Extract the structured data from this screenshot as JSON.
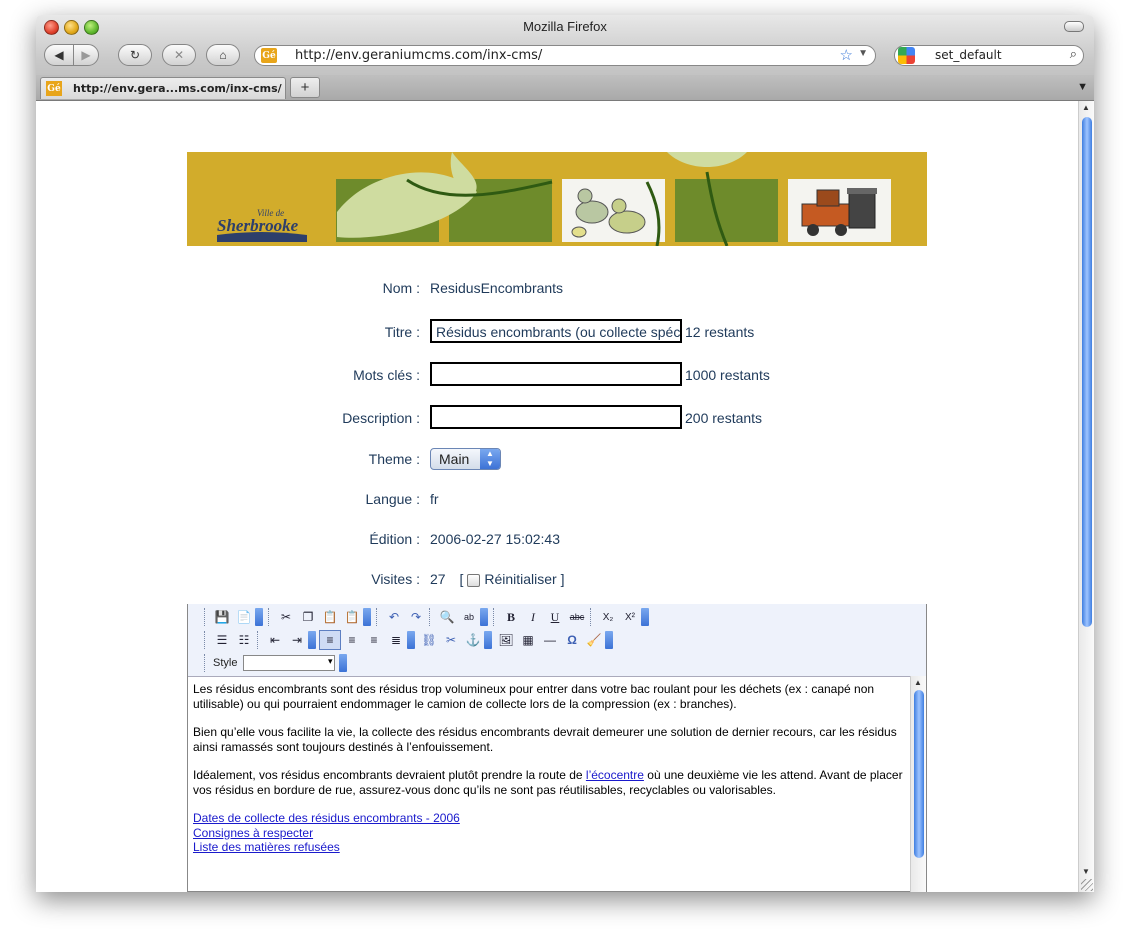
{
  "window": {
    "title": "Mozilla Firefox"
  },
  "nav": {
    "url": "http://env.geraniumcms.com/inx-cms/",
    "favicon_text": "Gé",
    "search_value": "set_default"
  },
  "tabs": [
    {
      "label": "http://env.gera...ms.com/inx-cms/"
    }
  ],
  "newtab_label": "+",
  "banner": {
    "logo_line1": "Ville de",
    "logo_line2": "Sherbrooke"
  },
  "form": {
    "nom": {
      "label": "Nom :",
      "value": "ResidusEncombrants"
    },
    "titre": {
      "label": "Titre :",
      "value": "Résidus encombrants (ou collecte spéciale)",
      "remaining": "12 restants"
    },
    "mots_cles": {
      "label": "Mots clés :",
      "value": "",
      "remaining": "1000 restants"
    },
    "description": {
      "label": "Description :",
      "value": "",
      "remaining": "200 restants"
    },
    "theme": {
      "label": "Theme :",
      "value": "Main"
    },
    "langue": {
      "label": "Langue :",
      "value": "fr"
    },
    "edition": {
      "label": "Édition :",
      "value": "2006-02-27 15:02:43"
    },
    "visites": {
      "label": "Visites :",
      "value": "27",
      "reset_label": "Réinitialiser",
      "open_bracket": "[",
      "close_bracket": "]"
    }
  },
  "editor": {
    "style_label": "Style",
    "paragraphs": [
      "Les résidus encombrants sont des résidus trop volumineux pour entrer dans votre bac roulant pour les déchets (ex : canapé non utilisable) ou qui pourraient endommager le camion de collecte lors de la compression (ex : branches).",
      "Bien qu’elle vous facilite la vie, la collecte des résidus encombrants devrait demeurer une solution de dernier recours, car les résidus ainsi ramassés sont toujours destinés à l’enfouissement."
    ],
    "p3_before": "Idéalement, vos résidus encombrants devraient plutôt prendre la route de ",
    "p3_link": "l’écocentre",
    "p3_after": " où une deuxième vie les attend. Avant de placer vos résidus en bordure de rue, assurez-vous donc qu’ils ne sont pas réutilisables, recyclables ou valorisables.",
    "links": [
      "Dates de collecte des résidus encombrants - 2006",
      "Consignes à respecter",
      "Liste des matières refusées"
    ]
  }
}
